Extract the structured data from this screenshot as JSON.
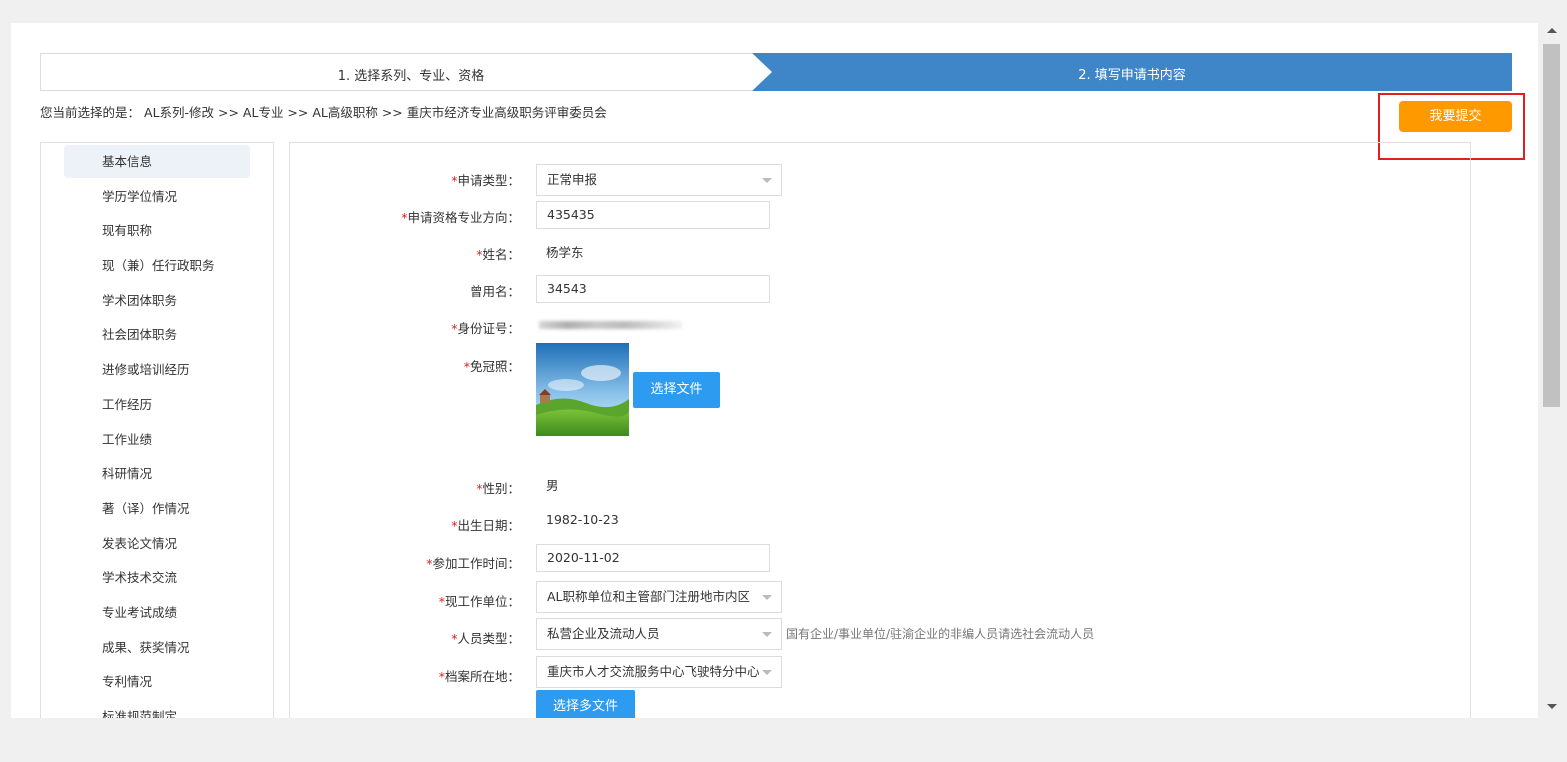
{
  "steps": {
    "step1": "1. 选择系列、专业、资格",
    "step2": "2. 填写申请书内容"
  },
  "breadcrumb": {
    "prefix": "您当前选择的是：",
    "path": "AL系列-修改 >> AL专业 >> AL高级职称 >> 重庆市经济专业高级职务评审委员会"
  },
  "submit_label": "我要提交",
  "sidebar": {
    "items": [
      {
        "label": "基本信息",
        "active": true
      },
      {
        "label": "学历学位情况"
      },
      {
        "label": "现有职称"
      },
      {
        "label": "现（兼）任行政职务"
      },
      {
        "label": "学术团体职务"
      },
      {
        "label": "社会团体职务"
      },
      {
        "label": "进修或培训经历"
      },
      {
        "label": "工作经历"
      },
      {
        "label": "工作业绩"
      },
      {
        "label": "科研情况"
      },
      {
        "label": "著（译）作情况"
      },
      {
        "label": "发表论文情况"
      },
      {
        "label": "学术技术交流"
      },
      {
        "label": "专业考试成绩"
      },
      {
        "label": "成果、获奖情况"
      },
      {
        "label": "专利情况"
      },
      {
        "label": "标准规范制定"
      }
    ]
  },
  "form": {
    "apply_type": {
      "label": "申请类型：",
      "value": "正常申报"
    },
    "direction": {
      "label": "申请资格专业方向：",
      "value": "435435"
    },
    "name": {
      "label": "姓名：",
      "value": "杨学东"
    },
    "former_name": {
      "label": "曾用名：",
      "value": "34543"
    },
    "id_no": {
      "label": "身份证号："
    },
    "photo": {
      "label": "免冠照：",
      "button": "选择文件"
    },
    "gender": {
      "label": "性别：",
      "value": "男"
    },
    "birth": {
      "label": "出生日期：",
      "value": "1982-10-23"
    },
    "work_start": {
      "label": "参加工作时间：",
      "value": "2020-11-02"
    },
    "work_unit": {
      "label": "现工作单位：",
      "value": "AL职称单位和主管部门注册地市内区"
    },
    "person_type": {
      "label": "人员类型：",
      "value": "私营企业及流动人员",
      "hint": "国有企业/事业单位/驻渝企业的非编人员请选社会流动人员"
    },
    "archive": {
      "label": "档案所在地：",
      "value": "重庆市人才交流服务中心飞驶特分中心",
      "button": "选择多文件"
    }
  },
  "colors": {
    "step_active": "#3e86c8",
    "submit": "#ff9900",
    "button": "#2d9bf0",
    "required": "#e02020",
    "highlight": "#e02020"
  }
}
